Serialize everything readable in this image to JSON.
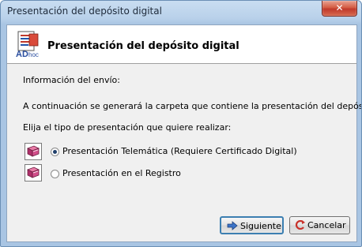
{
  "window": {
    "title": "Presentación del depósito digital",
    "close_label": "✕"
  },
  "header": {
    "title": "Presentación del depósito digital",
    "logo_text": "AD hoc"
  },
  "body": {
    "info_label": "Información del envío:",
    "description": "A continuación se generará la carpeta que contiene la presentación del depósito.",
    "prompt": "Elija el tipo de presentación que quiere realizar:"
  },
  "options": [
    {
      "label": "Presentación Telemática (Requiere Certificado Digital)",
      "selected": true,
      "icon": "book-icon"
    },
    {
      "label": "Presentación en el Registro",
      "selected": false,
      "icon": "book-icon"
    }
  ],
  "buttons": {
    "next_label": "Siguiente",
    "cancel_label": "Cancelar"
  },
  "colors": {
    "titlebar": "#b9d1ea",
    "close": "#c0392b",
    "accent": "#3c7fb1"
  }
}
